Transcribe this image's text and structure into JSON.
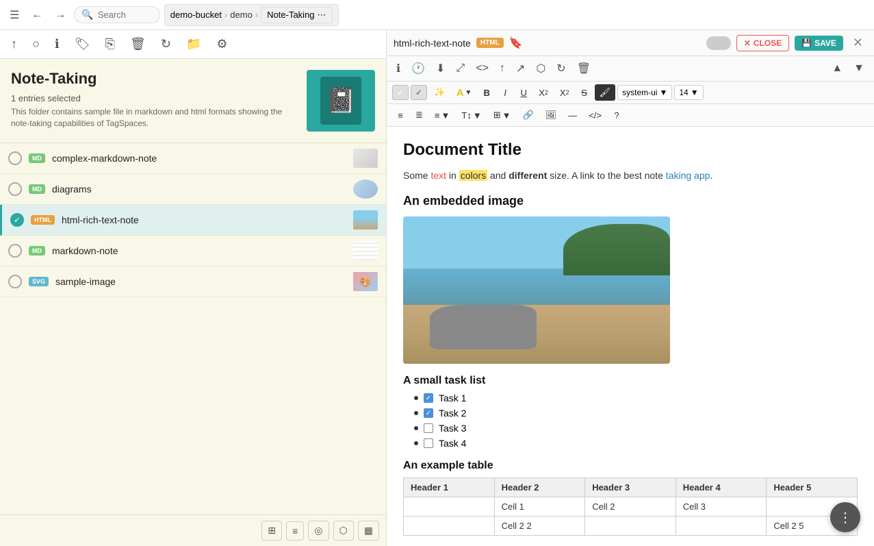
{
  "topNav": {
    "menu_icon": "☰",
    "back_icon": "←",
    "forward_icon": "→",
    "search_placeholder": "Search",
    "breadcrumb": {
      "bucket": "demo-bucket",
      "sep1": "›",
      "folder": "demo",
      "sep2": "›",
      "subfolder": "Note-Taking"
    }
  },
  "toolbar": {
    "icons": [
      "↑",
      "○",
      "ℹ",
      "🏷",
      "⎘",
      "🗑",
      "↻",
      "📁",
      "⚙"
    ]
  },
  "folderInfo": {
    "title": "Note-Taking",
    "selected": "1 entries selected",
    "description": "This folder contains sample file in markdown and html formats showing the note-taking capabilities of TagSpaces."
  },
  "files": [
    {
      "id": "complex-markdown-note",
      "name": "complex-markdown-note",
      "badge": "MD",
      "badgeClass": "badge-md",
      "selected": false
    },
    {
      "id": "diagrams",
      "name": "diagrams",
      "badge": "MD",
      "badgeClass": "badge-md",
      "selected": false
    },
    {
      "id": "html-rich-text-note",
      "name": "html-rich-text-note",
      "badge": "HTML",
      "badgeClass": "badge-html",
      "selected": true
    },
    {
      "id": "markdown-note",
      "name": "markdown-note",
      "badge": "MD",
      "badgeClass": "badge-md",
      "selected": false
    },
    {
      "id": "sample-image",
      "name": "sample-image",
      "badge": "SVG",
      "badgeClass": "badge-svg",
      "selected": false
    }
  ],
  "editor": {
    "filename": "html-rich-text-note",
    "badge": "HTML",
    "close_label": "CLOSE",
    "save_label": "SAVE",
    "docTitle": "Document Title",
    "docPara": {
      "prefix": "Some ",
      "colored": "text",
      "middle1": " in ",
      "highlight": "colors",
      "middle2": " and ",
      "bold": "different",
      "suffix": " size. A link to the best note ",
      "linkText": "taking app",
      "linkUrl": "#",
      "end": "."
    },
    "imageSection": "An embedded image",
    "taskSection": "A small task list",
    "tasks": [
      {
        "label": "Task 1",
        "checked": true
      },
      {
        "label": "Task 2",
        "checked": true
      },
      {
        "label": "Task 3",
        "checked": false
      },
      {
        "label": "Task 4",
        "checked": false
      }
    ],
    "tableSection": "An example table",
    "tableHeaders": [
      "Header 1",
      "Header 2",
      "Header 3",
      "Header 4",
      "Header 5"
    ],
    "tableRows": [
      [
        "",
        "Cell 1",
        "Cell 2",
        "Cell 3",
        ""
      ],
      [
        "",
        "Cell 2  2",
        "",
        "",
        "Cell 2  5"
      ]
    ],
    "fontFamily": "system-ui",
    "fontSize": "14"
  },
  "viewButtons": [
    "⊞",
    "≡",
    "◎",
    "⬡",
    "▦"
  ],
  "fab": "⋮"
}
